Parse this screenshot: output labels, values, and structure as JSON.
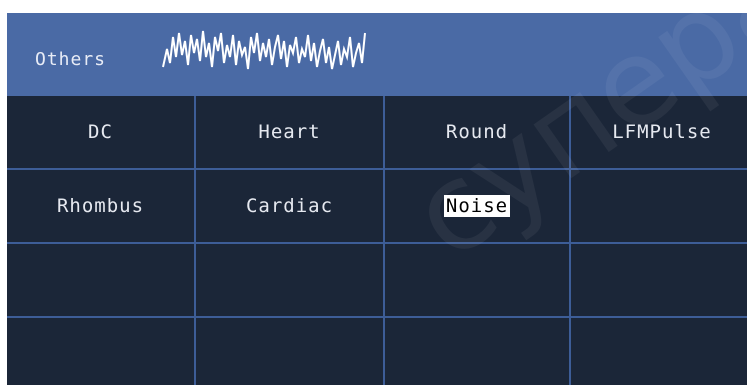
{
  "header": {
    "title": "Others",
    "icon": "waveform-icon"
  },
  "watermark": "суперайс",
  "grid": {
    "cells": [
      [
        "DC",
        "Heart",
        "Round",
        "LFMPulse"
      ],
      [
        "Rhombus",
        "Cardiac",
        "Noise",
        ""
      ],
      [
        "",
        "",
        "",
        ""
      ],
      [
        "",
        "",
        "",
        ""
      ]
    ],
    "selected": "Noise"
  },
  "colors": {
    "panel_background": "#3d5d97",
    "header_background": "#4a6aa5",
    "cell_background": "#1b2638",
    "text": "#e6e9f0",
    "selected_background": "#ffffff",
    "selected_text": "#000000"
  }
}
